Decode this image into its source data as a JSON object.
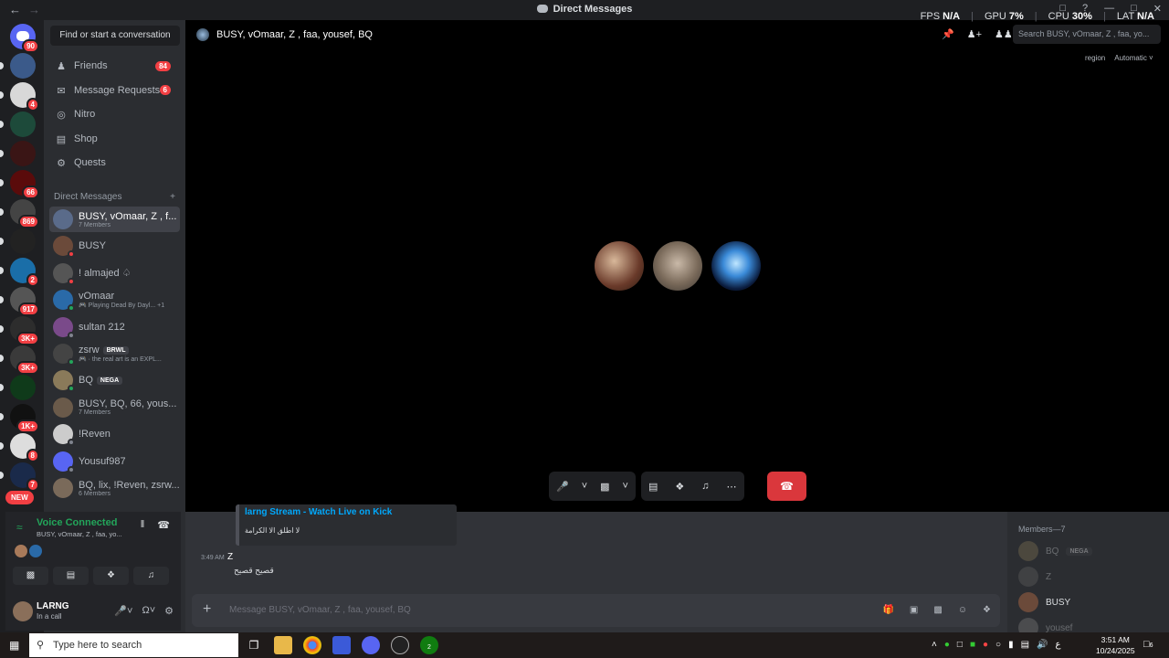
{
  "window": {
    "title": "Direct Messages",
    "perf": {
      "fps_label": "FPS",
      "fps": "N/A",
      "gpu_label": "GPU",
      "gpu": "7%",
      "cpu_label": "CPU",
      "cpu": "30%",
      "lat_label": "LAT",
      "lat": "N/A"
    }
  },
  "rail": {
    "home_badge": "90",
    "servers": [
      {
        "badge": "",
        "color": "#3b5a8a"
      },
      {
        "badge": "4",
        "color": "#d8d8d8"
      },
      {
        "badge": "",
        "color": "#1d4a3a"
      },
      {
        "badge": "",
        "color": "#3a1515"
      },
      {
        "badge": "66",
        "color": "#5a0b0b"
      },
      {
        "badge": "869",
        "color": "#444"
      },
      {
        "badge": "",
        "color": "#222"
      },
      {
        "badge": "2",
        "color": "#1a6ea8"
      },
      {
        "badge": "917",
        "color": "#555"
      },
      {
        "badge": "3K+",
        "color": "#2d2d2d"
      },
      {
        "badge": "3K+",
        "color": "#3a3a3a"
      },
      {
        "badge": "",
        "color": "#0f3a1a"
      },
      {
        "badge": "1K+",
        "color": "#111"
      },
      {
        "badge": "8",
        "color": "#ddd"
      },
      {
        "badge": "7",
        "color": "#1a2a4a"
      }
    ],
    "new_label": "NEW"
  },
  "sidebar": {
    "search_label": "Find or start a conversation",
    "nav": [
      {
        "label": "Friends",
        "count": "84",
        "icon": "friends-icon"
      },
      {
        "label": "Message Requests",
        "count": "6",
        "icon": "envelope-icon"
      },
      {
        "label": "Nitro",
        "count": "",
        "icon": "nitro-icon"
      },
      {
        "label": "Shop",
        "count": "",
        "icon": "shop-icon"
      },
      {
        "label": "Quests",
        "count": "",
        "icon": "quests-icon"
      }
    ],
    "dm_header": "Direct Messages",
    "dms": [
      {
        "name": "BUSY, vOmaar, Z  , f...",
        "sub": "7 Members",
        "tag": "",
        "status": "",
        "av": "#5a6b8a"
      },
      {
        "name": "BUSY",
        "sub": "",
        "tag": "",
        "status": "#f23f43",
        "av": "#6b4a3a"
      },
      {
        "name": "! almajed ♤",
        "sub": "",
        "tag": "",
        "status": "#f23f43",
        "av": "#555"
      },
      {
        "name": "vOmaar",
        "sub": "🎮 Playing Dead By Dayl... +1",
        "tag": "",
        "status": "#23a55a",
        "av": "#2a6aa8"
      },
      {
        "name": "sultan 212",
        "sub": "",
        "tag": "",
        "status": "#80848e",
        "av": "#7a4a8a"
      },
      {
        "name": "zsrw",
        "sub": "🎮 · the real art is an EXPL...",
        "tag": "BRWL",
        "status": "#23a55a",
        "av": "#444"
      },
      {
        "name": "BQ",
        "sub": "",
        "tag": "NEGA",
        "status": "#23a55a",
        "av": "#8a7a5a"
      },
      {
        "name": "BUSY, BQ, 66, yous...",
        "sub": "7 Members",
        "tag": "",
        "status": "",
        "av": "#6a5a4a"
      },
      {
        "name": "!Reven",
        "sub": "",
        "tag": "",
        "status": "#80848e",
        "av": "#ccc"
      },
      {
        "name": "Yousuf987",
        "sub": "",
        "tag": "",
        "status": "#80848e",
        "av": "#5865f2"
      },
      {
        "name": "BQ, lix, !Reven, zsrw...",
        "sub": "6 Members",
        "tag": "",
        "status": "",
        "av": "#7a6a5a"
      }
    ]
  },
  "voice": {
    "title": "Voice Connected",
    "sub": "BUSY, vOmaar, Z  , faa, yo..."
  },
  "user": {
    "name": "LARNG",
    "status": "In a call"
  },
  "call": {
    "title": "BUSY, vOmaar, Z  , faa, yousef, BQ",
    "search_placeholder": "Search BUSY, vOmaar, Z  , faa, yo...",
    "region_label": "region",
    "region_value": "Automatic"
  },
  "chat": {
    "embed_title": "larng Stream - Watch Live on Kick",
    "embed_desc": "لا اطلق الا الكرامة",
    "message_time": "3:49 AM",
    "message_author": "Z",
    "message_text": "قصيح قصيح",
    "composer_placeholder": "Message BUSY, vOmaar, Z  , faa, yousef, BQ"
  },
  "members": {
    "header": "Members—7",
    "list": [
      {
        "name": "BQ",
        "tag": "NEGA",
        "dim": true,
        "av": "#8a7a5a"
      },
      {
        "name": "Z",
        "tag": "",
        "dim": true,
        "av": "#666"
      },
      {
        "name": "BUSY",
        "tag": "",
        "dim": false,
        "av": "#6b4a3a"
      },
      {
        "name": "yousef",
        "tag": "",
        "dim": true,
        "av": "#888"
      }
    ]
  },
  "taskbar": {
    "search_placeholder": "Type here to search",
    "time": "3:51 AM",
    "date": "10/24/2025",
    "xbox_badge": "2",
    "notif_count": "6",
    "lang": "ع"
  }
}
